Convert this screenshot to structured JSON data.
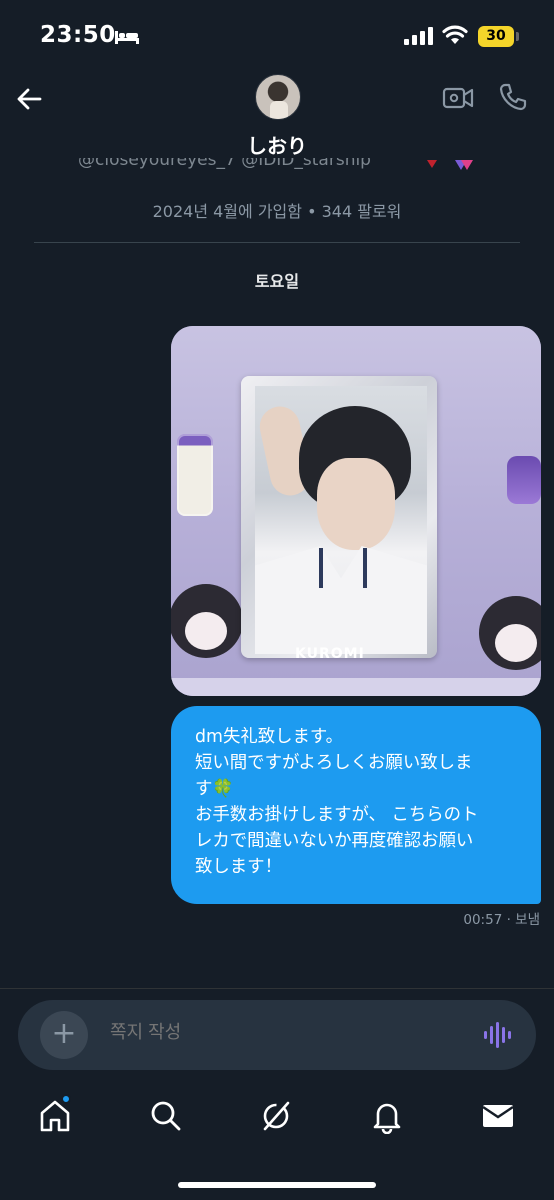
{
  "status_bar": {
    "time": "23:50",
    "battery": "30",
    "icons": [
      "bed-icon",
      "signal-icon",
      "wifi-icon",
      "battery-icon"
    ]
  },
  "header": {
    "name": "しおり",
    "bio_fragment": "@closeyoureyes_7  @IDID_starship",
    "meta": "2024년 4월에 가입함 • 344 팔로워",
    "icons": [
      "back-arrow-icon",
      "video-call-icon",
      "phone-icon"
    ]
  },
  "conversation": {
    "day_label": "토요일",
    "photo_brand_text": "KUROMI",
    "message_text": "dm失礼致します。\n短い間ですがよろしくお願い致しま\nす🍀\nお手数お掛けしますが、 こちらのト\nレカで間違いないか再度確認お願い\n致します！",
    "timestamp": "00:57 · 보냄"
  },
  "composer": {
    "placeholder": "쪽지 작성",
    "icons": [
      "plus-icon",
      "voice-icon"
    ]
  },
  "tab_bar": {
    "tabs": [
      "home",
      "search",
      "grok",
      "notifications",
      "messages"
    ],
    "accent": "#1d9bf0"
  },
  "colors": {
    "background": "#151d27",
    "bubble": "#1d9bf0",
    "muted_text": "#8b98a5"
  }
}
